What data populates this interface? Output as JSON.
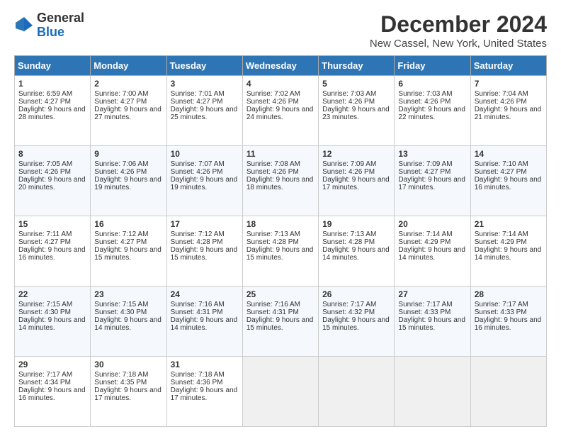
{
  "header": {
    "logo_general": "General",
    "logo_blue": "Blue",
    "month_title": "December 2024",
    "location": "New Cassel, New York, United States"
  },
  "weekdays": [
    "Sunday",
    "Monday",
    "Tuesday",
    "Wednesday",
    "Thursday",
    "Friday",
    "Saturday"
  ],
  "weeks": [
    [
      {
        "day": "1",
        "sunrise": "Sunrise: 6:59 AM",
        "sunset": "Sunset: 4:27 PM",
        "daylight": "Daylight: 9 hours and 28 minutes."
      },
      {
        "day": "2",
        "sunrise": "Sunrise: 7:00 AM",
        "sunset": "Sunset: 4:27 PM",
        "daylight": "Daylight: 9 hours and 27 minutes."
      },
      {
        "day": "3",
        "sunrise": "Sunrise: 7:01 AM",
        "sunset": "Sunset: 4:27 PM",
        "daylight": "Daylight: 9 hours and 25 minutes."
      },
      {
        "day": "4",
        "sunrise": "Sunrise: 7:02 AM",
        "sunset": "Sunset: 4:26 PM",
        "daylight": "Daylight: 9 hours and 24 minutes."
      },
      {
        "day": "5",
        "sunrise": "Sunrise: 7:03 AM",
        "sunset": "Sunset: 4:26 PM",
        "daylight": "Daylight: 9 hours and 23 minutes."
      },
      {
        "day": "6",
        "sunrise": "Sunrise: 7:03 AM",
        "sunset": "Sunset: 4:26 PM",
        "daylight": "Daylight: 9 hours and 22 minutes."
      },
      {
        "day": "7",
        "sunrise": "Sunrise: 7:04 AM",
        "sunset": "Sunset: 4:26 PM",
        "daylight": "Daylight: 9 hours and 21 minutes."
      }
    ],
    [
      {
        "day": "8",
        "sunrise": "Sunrise: 7:05 AM",
        "sunset": "Sunset: 4:26 PM",
        "daylight": "Daylight: 9 hours and 20 minutes."
      },
      {
        "day": "9",
        "sunrise": "Sunrise: 7:06 AM",
        "sunset": "Sunset: 4:26 PM",
        "daylight": "Daylight: 9 hours and 19 minutes."
      },
      {
        "day": "10",
        "sunrise": "Sunrise: 7:07 AM",
        "sunset": "Sunset: 4:26 PM",
        "daylight": "Daylight: 9 hours and 19 minutes."
      },
      {
        "day": "11",
        "sunrise": "Sunrise: 7:08 AM",
        "sunset": "Sunset: 4:26 PM",
        "daylight": "Daylight: 9 hours and 18 minutes."
      },
      {
        "day": "12",
        "sunrise": "Sunrise: 7:09 AM",
        "sunset": "Sunset: 4:26 PM",
        "daylight": "Daylight: 9 hours and 17 minutes."
      },
      {
        "day": "13",
        "sunrise": "Sunrise: 7:09 AM",
        "sunset": "Sunset: 4:27 PM",
        "daylight": "Daylight: 9 hours and 17 minutes."
      },
      {
        "day": "14",
        "sunrise": "Sunrise: 7:10 AM",
        "sunset": "Sunset: 4:27 PM",
        "daylight": "Daylight: 9 hours and 16 minutes."
      }
    ],
    [
      {
        "day": "15",
        "sunrise": "Sunrise: 7:11 AM",
        "sunset": "Sunset: 4:27 PM",
        "daylight": "Daylight: 9 hours and 16 minutes."
      },
      {
        "day": "16",
        "sunrise": "Sunrise: 7:12 AM",
        "sunset": "Sunset: 4:27 PM",
        "daylight": "Daylight: 9 hours and 15 minutes."
      },
      {
        "day": "17",
        "sunrise": "Sunrise: 7:12 AM",
        "sunset": "Sunset: 4:28 PM",
        "daylight": "Daylight: 9 hours and 15 minutes."
      },
      {
        "day": "18",
        "sunrise": "Sunrise: 7:13 AM",
        "sunset": "Sunset: 4:28 PM",
        "daylight": "Daylight: 9 hours and 15 minutes."
      },
      {
        "day": "19",
        "sunrise": "Sunrise: 7:13 AM",
        "sunset": "Sunset: 4:28 PM",
        "daylight": "Daylight: 9 hours and 14 minutes."
      },
      {
        "day": "20",
        "sunrise": "Sunrise: 7:14 AM",
        "sunset": "Sunset: 4:29 PM",
        "daylight": "Daylight: 9 hours and 14 minutes."
      },
      {
        "day": "21",
        "sunrise": "Sunrise: 7:14 AM",
        "sunset": "Sunset: 4:29 PM",
        "daylight": "Daylight: 9 hours and 14 minutes."
      }
    ],
    [
      {
        "day": "22",
        "sunrise": "Sunrise: 7:15 AM",
        "sunset": "Sunset: 4:30 PM",
        "daylight": "Daylight: 9 hours and 14 minutes."
      },
      {
        "day": "23",
        "sunrise": "Sunrise: 7:15 AM",
        "sunset": "Sunset: 4:30 PM",
        "daylight": "Daylight: 9 hours and 14 minutes."
      },
      {
        "day": "24",
        "sunrise": "Sunrise: 7:16 AM",
        "sunset": "Sunset: 4:31 PM",
        "daylight": "Daylight: 9 hours and 14 minutes."
      },
      {
        "day": "25",
        "sunrise": "Sunrise: 7:16 AM",
        "sunset": "Sunset: 4:31 PM",
        "daylight": "Daylight: 9 hours and 15 minutes."
      },
      {
        "day": "26",
        "sunrise": "Sunrise: 7:17 AM",
        "sunset": "Sunset: 4:32 PM",
        "daylight": "Daylight: 9 hours and 15 minutes."
      },
      {
        "day": "27",
        "sunrise": "Sunrise: 7:17 AM",
        "sunset": "Sunset: 4:33 PM",
        "daylight": "Daylight: 9 hours and 15 minutes."
      },
      {
        "day": "28",
        "sunrise": "Sunrise: 7:17 AM",
        "sunset": "Sunset: 4:33 PM",
        "daylight": "Daylight: 9 hours and 16 minutes."
      }
    ],
    [
      {
        "day": "29",
        "sunrise": "Sunrise: 7:17 AM",
        "sunset": "Sunset: 4:34 PM",
        "daylight": "Daylight: 9 hours and 16 minutes."
      },
      {
        "day": "30",
        "sunrise": "Sunrise: 7:18 AM",
        "sunset": "Sunset: 4:35 PM",
        "daylight": "Daylight: 9 hours and 17 minutes."
      },
      {
        "day": "31",
        "sunrise": "Sunrise: 7:18 AM",
        "sunset": "Sunset: 4:36 PM",
        "daylight": "Daylight: 9 hours and 17 minutes."
      },
      null,
      null,
      null,
      null
    ]
  ]
}
